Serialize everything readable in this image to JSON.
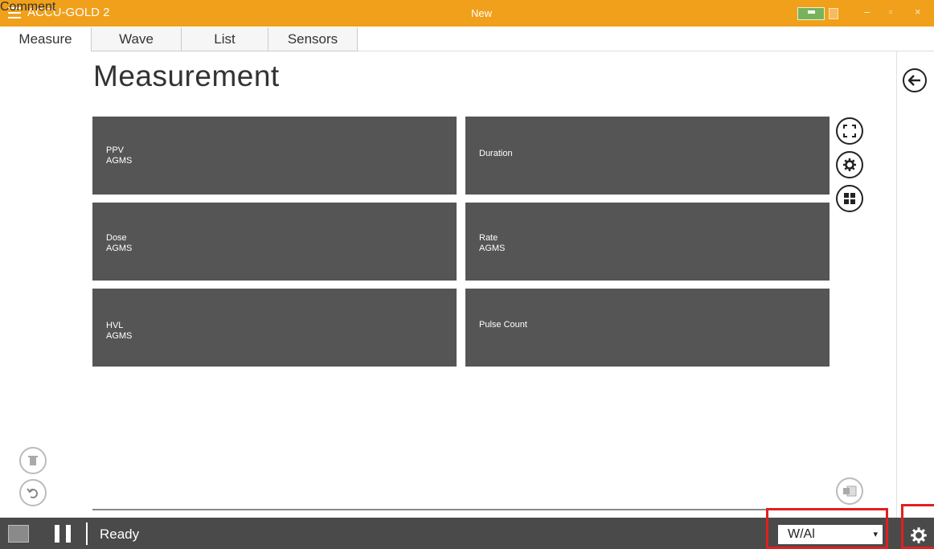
{
  "titlebar": {
    "app_title": "ACCU-GOLD 2",
    "doc_title": "New",
    "minimize": "–",
    "maximize": "▫",
    "close": "×"
  },
  "tabs": [
    {
      "label": "Measure",
      "active": true
    },
    {
      "label": "Wave",
      "active": false
    },
    {
      "label": "List",
      "active": false
    },
    {
      "label": "Sensors",
      "active": false
    }
  ],
  "main": {
    "title": "Measurement",
    "tiles": [
      {
        "name": "PPV",
        "sub": "AGMS"
      },
      {
        "name": "Duration",
        "sub": ""
      },
      {
        "name": "Dose",
        "sub": "AGMS"
      },
      {
        "name": "Rate",
        "sub": "AGMS"
      },
      {
        "name": "HVL",
        "sub": "AGMS"
      },
      {
        "name": "Pulse Count",
        "sub": ""
      }
    ]
  },
  "side_panel": {
    "comment_label": "Comment"
  },
  "bottombar": {
    "status": "Ready",
    "unit_selected": "W/Al"
  },
  "colors": {
    "accent": "#f0a01a",
    "tile": "#555555",
    "bottombar": "#4a4a4a",
    "highlight": "#e02020"
  },
  "icons": {
    "menu": "hamburger-icon",
    "back": "arrow-left-circle-icon",
    "expand": "fullscreen-icon",
    "settings": "gear-icon",
    "layout": "grid-icon",
    "delete": "trash-icon",
    "undo": "undo-icon",
    "export": "excel-icon",
    "usb": "usb-icon",
    "pause": "pause-icon"
  }
}
